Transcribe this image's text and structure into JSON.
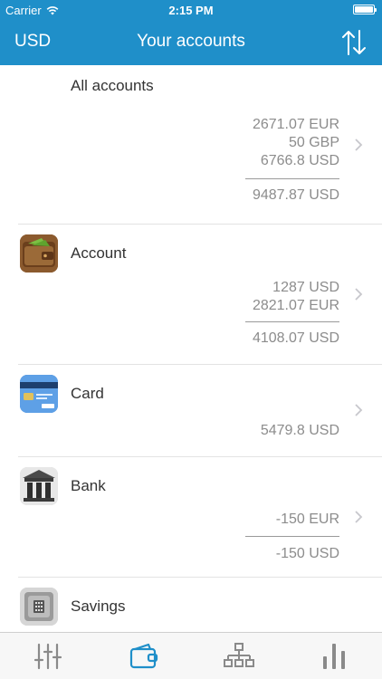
{
  "status_bar": {
    "carrier": "Carrier",
    "time": "2:15 PM"
  },
  "nav": {
    "currency_button": "USD",
    "title": "Your accounts",
    "sort_icon": "sort-arrows-icon"
  },
  "accounts": [
    {
      "name": "All accounts",
      "icon": null,
      "amounts": [
        "2671.07 EUR",
        "50 GBP",
        "6766.8 USD"
      ],
      "total": "9487.87 USD"
    },
    {
      "name": "Account",
      "icon": "wallet-icon",
      "amounts": [
        "1287 USD",
        "2821.07 EUR"
      ],
      "total": "4108.07 USD"
    },
    {
      "name": "Card",
      "icon": "credit-card-icon",
      "amounts": [],
      "total": "5479.8 USD"
    },
    {
      "name": "Bank",
      "icon": "bank-icon",
      "amounts": [
        "-150 EUR"
      ],
      "total": "-150 USD"
    },
    {
      "name": "Savings",
      "icon": "safe-icon",
      "amounts": [],
      "total": ""
    }
  ],
  "tabbar": {
    "tabs": [
      {
        "icon": "sliders-icon",
        "selected": false
      },
      {
        "icon": "wallet-tab-icon",
        "selected": true
      },
      {
        "icon": "hierarchy-icon",
        "selected": false
      },
      {
        "icon": "bar-chart-icon",
        "selected": false
      }
    ]
  },
  "colors": {
    "header": "#1f8fc9",
    "accent": "#1f8fc9",
    "text_secondary": "#8c8c8c",
    "tab_inactive": "#8a8a8a"
  }
}
